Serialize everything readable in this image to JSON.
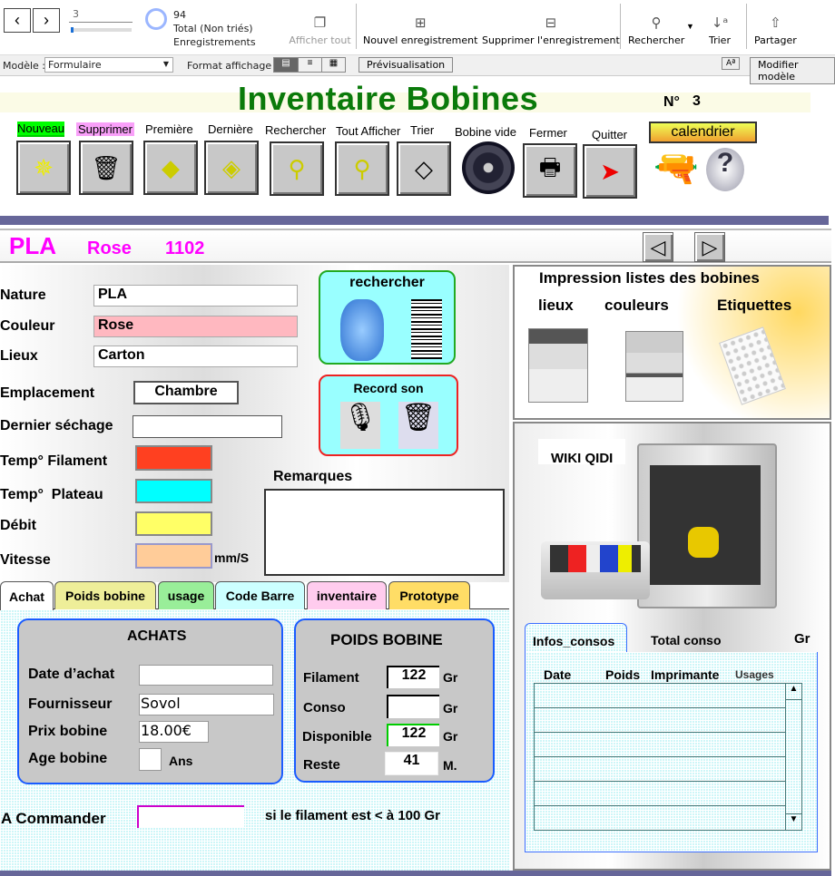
{
  "toolbar": {
    "record_input": "3",
    "record_count": "94",
    "total_label": "Total (Non triés)",
    "records_label": "Enregistrements",
    "show_all": "Afficher tout",
    "new_record": "Nouvel enregistrement",
    "delete_record": "Supprimer l'enregistrement",
    "search": "Rechercher",
    "sort": "Trier",
    "share": "Partager",
    "progress_fraction": 0.03
  },
  "layoutbar": {
    "model_label": "Modèle :",
    "model_value": "Formulaire",
    "display_format_label": "Format affichage :",
    "preview": "Prévisualisation",
    "text_size": "Aª",
    "edit_layout": "Modifier modèle"
  },
  "header": {
    "title": "Inventaire Bobines",
    "number_label": "N°",
    "number": "3",
    "title_color": "#0a7a0a"
  },
  "buttons": [
    {
      "label": "Nouveau"
    },
    {
      "label": "Supprimer"
    },
    {
      "label": "Première"
    },
    {
      "label": "Dernière"
    },
    {
      "label": "Rechercher"
    },
    {
      "label": "Tout Afficher"
    },
    {
      "label": "Trier"
    },
    {
      "label": "Bobine vide"
    },
    {
      "label": "Fermer"
    },
    {
      "label": "Quitter"
    },
    {
      "label": "calendrier"
    }
  ],
  "record": {
    "type": "PLA",
    "color": "Rose",
    "code": "1102"
  },
  "form": {
    "nature_label": "Nature",
    "nature": "PLA",
    "couleur_label": "Couleur",
    "couleur": "Rose",
    "lieux_label": "Lieux",
    "lieux": "Carton",
    "emplacement_label": "Emplacement",
    "emplacement": "Chambre",
    "sechage_label": "Dernier séchage",
    "sechage": "",
    "temp_fil_label": "Temp° Filament",
    "temp_plat_label": "Temp°  Plateau",
    "debit_label": "Débit",
    "vitesse_label": "Vitesse",
    "vitesse_unit": "mm/S",
    "remarques_label": "Remarques",
    "remarques": "",
    "rechercher": "rechercher",
    "record_son": "Record son"
  },
  "print": {
    "title": "Impression listes des bobines",
    "lieux": "lieux",
    "couleurs": "couleurs",
    "etiquettes": "Etiquettes"
  },
  "wiki": {
    "label": "WIKI QIDI"
  },
  "tabs": [
    {
      "label": "Achat",
      "color": "#ffffff"
    },
    {
      "label": "Poids bobine",
      "color": "#eeee99"
    },
    {
      "label": "usage",
      "color": "#99ee99"
    },
    {
      "label": "Code Barre",
      "color": "#ccffff"
    },
    {
      "label": "inventaire",
      "color": "#ffccee"
    },
    {
      "label": "Prototype",
      "color": "#ffdd66"
    }
  ],
  "achats": {
    "title": "ACHATS",
    "date_label": "Date d’achat",
    "date": "",
    "fournisseur_label": "Fournisseur",
    "fournisseur": "Sovol",
    "prix_label": "Prix bobine",
    "prix": "18.00€",
    "age_label": "Age bobine",
    "age": "",
    "age_unit": "Ans"
  },
  "poids": {
    "title": "POIDS BOBINE",
    "filament_label": "Filament",
    "filament": "122",
    "conso_label": "Conso",
    "conso": "",
    "dispo_label": "Disponible",
    "dispo": "122",
    "reste_label": "Reste",
    "reste": "41",
    "unit_gr": "Gr",
    "unit_m": "M."
  },
  "commande": {
    "label": "A Commander",
    "value": "",
    "note": "si le filament est < à 100 Gr"
  },
  "consos": {
    "tab": "Infos_consos",
    "total_label": "Total conso",
    "total_unit": "Gr",
    "columns": [
      "Date",
      "Poids",
      "Imprimante",
      "Usages"
    ]
  }
}
